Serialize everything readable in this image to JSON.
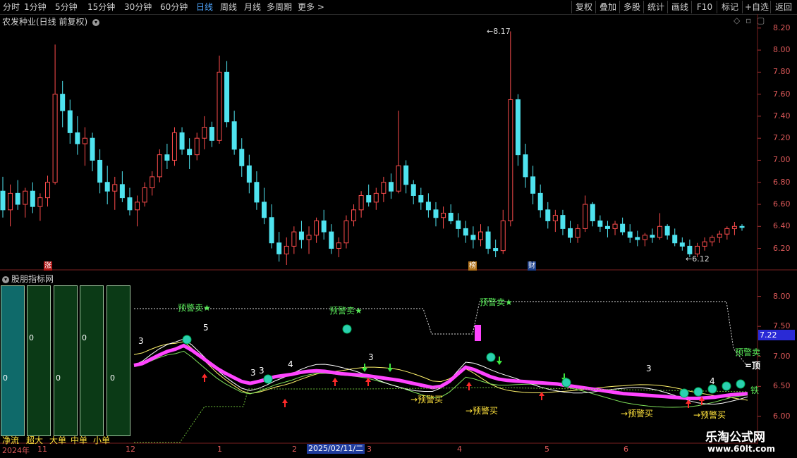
{
  "toolbar": {
    "periods": [
      "分时",
      "1分钟",
      "5分钟",
      "15分钟",
      "30分钟",
      "60分钟",
      "日线",
      "周线",
      "月线",
      "多周期",
      "更多 >"
    ],
    "active_period": "日线",
    "buttons": [
      "复权",
      "叠加",
      "多股",
      "统计",
      "画线",
      "F10",
      "标记",
      "+自选",
      "返回"
    ]
  },
  "main_panel": {
    "title": "农发种业(日线 前复权)",
    "y_ticks": [
      "8.20",
      "8.00",
      "7.80",
      "7.60",
      "7.40",
      "7.20",
      "7.00",
      "6.80",
      "6.60",
      "6.40",
      "6.20"
    ],
    "high_label": "8.17",
    "low_label": "6.12",
    "markers": [
      "涨",
      "榜",
      "财"
    ]
  },
  "indicator_panel": {
    "title": "股朋指标网",
    "y_ticks": [
      "8.00",
      "7.50",
      "7.00",
      "6.50",
      "6.00"
    ],
    "current_value": "7.22",
    "flow_values": [
      "0",
      "0",
      "0",
      "0",
      "0"
    ],
    "flow_labels": [
      "净流",
      "超大",
      "大单",
      "中单",
      "小单"
    ],
    "sell_warn": "预警卖★",
    "buy_warn": "→预警买",
    "side_warn": "预警卖",
    "numbers": [
      "3",
      "5",
      "3",
      "3",
      "4",
      "3",
      "3",
      "4"
    ],
    "right_tag_top": "=顶",
    "right_tag_bottom": "铁"
  },
  "x_axis": {
    "labels": [
      "2024年",
      "11",
      "12",
      "1",
      "2",
      "3",
      "4",
      "5",
      "6"
    ],
    "selected_date": "2025/02/11/二"
  },
  "watermark": {
    "title": "乐淘公式网",
    "url": "www.60lt.com"
  },
  "colors": {
    "up": "#ff4d4d",
    "down": "#4fe3ef",
    "magenta": "#ff44ff",
    "accent": "#4fa6ff"
  },
  "chart_data": {
    "type": "candlestick",
    "series": [
      {
        "name": "",
        "type": "ohlc",
        "values": [
          [
            6.72,
            6.85,
            6.48,
            6.55
          ],
          [
            6.55,
            6.78,
            6.4,
            6.7
          ],
          [
            6.7,
            6.82,
            6.55,
            6.6
          ],
          [
            6.6,
            6.75,
            6.48,
            6.72
          ],
          [
            6.72,
            6.8,
            6.52,
            6.58
          ],
          [
            6.58,
            6.7,
            6.45,
            6.66
          ],
          [
            6.66,
            6.86,
            6.58,
            6.8
          ],
          [
            6.8,
            8.05,
            6.78,
            7.6
          ],
          [
            7.6,
            7.72,
            7.3,
            7.45
          ],
          [
            7.45,
            7.55,
            7.15,
            7.25
          ],
          [
            7.25,
            7.4,
            7.05,
            7.15
          ],
          [
            7.15,
            7.3,
            6.95,
            7.2
          ],
          [
            7.2,
            7.25,
            6.9,
            7.0
          ],
          [
            7.0,
            7.1,
            6.7,
            6.8
          ],
          [
            6.8,
            6.95,
            6.6,
            6.72
          ],
          [
            6.72,
            6.85,
            6.55,
            6.78
          ],
          [
            6.78,
            6.9,
            6.62,
            6.66
          ],
          [
            6.66,
            6.75,
            6.5,
            6.55
          ],
          [
            6.55,
            6.68,
            6.4,
            6.62
          ],
          [
            6.62,
            6.8,
            6.58,
            6.75
          ],
          [
            6.75,
            6.9,
            6.68,
            6.85
          ],
          [
            6.85,
            7.1,
            6.8,
            7.05
          ],
          [
            7.05,
            7.15,
            6.92,
            7.0
          ],
          [
            7.0,
            7.3,
            6.95,
            7.25
          ],
          [
            7.25,
            7.3,
            7.05,
            7.1
          ],
          [
            7.1,
            7.2,
            6.92,
            7.05
          ],
          [
            7.05,
            7.25,
            7.0,
            7.2
          ],
          [
            7.2,
            7.4,
            7.1,
            7.3
          ],
          [
            7.3,
            7.35,
            7.12,
            7.18
          ],
          [
            7.18,
            7.95,
            7.15,
            7.8
          ],
          [
            7.8,
            7.9,
            7.3,
            7.35
          ],
          [
            7.35,
            7.45,
            7.05,
            7.1
          ],
          [
            7.1,
            7.2,
            6.85,
            6.95
          ],
          [
            6.95,
            7.05,
            6.7,
            6.8
          ],
          [
            6.8,
            6.9,
            6.55,
            6.62
          ],
          [
            6.62,
            6.75,
            6.42,
            6.48
          ],
          [
            6.48,
            6.6,
            6.2,
            6.25
          ],
          [
            6.25,
            6.35,
            6.08,
            6.15
          ],
          [
            6.15,
            6.3,
            6.05,
            6.22
          ],
          [
            6.22,
            6.4,
            6.15,
            6.35
          ],
          [
            6.35,
            6.45,
            6.2,
            6.28
          ],
          [
            6.28,
            6.4,
            6.15,
            6.32
          ],
          [
            6.32,
            6.48,
            6.25,
            6.45
          ],
          [
            6.45,
            6.55,
            6.28,
            6.35
          ],
          [
            6.35,
            6.42,
            6.15,
            6.2
          ],
          [
            6.2,
            6.3,
            6.12,
            6.25
          ],
          [
            6.25,
            6.5,
            6.2,
            6.45
          ],
          [
            6.45,
            6.6,
            6.4,
            6.55
          ],
          [
            6.55,
            6.72,
            6.48,
            6.68
          ],
          [
            6.68,
            6.78,
            6.58,
            6.62
          ],
          [
            6.62,
            6.75,
            6.55,
            6.7
          ],
          [
            6.7,
            6.85,
            6.62,
            6.8
          ],
          [
            6.8,
            6.88,
            6.65,
            6.72
          ],
          [
            6.72,
            7.45,
            6.7,
            6.95
          ],
          [
            6.95,
            7.0,
            6.7,
            6.78
          ],
          [
            6.78,
            6.82,
            6.6,
            6.68
          ],
          [
            6.68,
            6.75,
            6.55,
            6.62
          ],
          [
            6.62,
            6.7,
            6.48,
            6.55
          ],
          [
            6.55,
            6.62,
            6.4,
            6.48
          ],
          [
            6.48,
            6.58,
            6.38,
            6.52
          ],
          [
            6.52,
            6.6,
            6.42,
            6.45
          ],
          [
            6.45,
            6.52,
            6.3,
            6.38
          ],
          [
            6.38,
            6.45,
            6.25,
            6.32
          ],
          [
            6.32,
            6.4,
            6.2,
            6.28
          ],
          [
            6.28,
            6.42,
            6.22,
            6.35
          ],
          [
            6.35,
            6.4,
            6.15,
            6.2
          ],
          [
            6.2,
            6.28,
            6.12,
            6.18
          ],
          [
            6.18,
            6.55,
            6.15,
            6.45
          ],
          [
            6.45,
            8.17,
            6.4,
            7.55
          ],
          [
            7.55,
            7.6,
            6.95,
            7.05
          ],
          [
            7.05,
            7.15,
            6.75,
            6.85
          ],
          [
            6.85,
            6.95,
            6.6,
            6.7
          ],
          [
            6.7,
            6.78,
            6.48,
            6.55
          ],
          [
            6.55,
            6.62,
            6.38,
            6.45
          ],
          [
            6.45,
            6.55,
            6.35,
            6.5
          ],
          [
            6.5,
            6.55,
            6.32,
            6.38
          ],
          [
            6.38,
            6.45,
            6.25,
            6.3
          ],
          [
            6.3,
            6.42,
            6.25,
            6.38
          ],
          [
            6.38,
            6.68,
            6.35,
            6.6
          ],
          [
            6.6,
            6.62,
            6.4,
            6.45
          ],
          [
            6.45,
            6.5,
            6.35,
            6.4
          ],
          [
            6.4,
            6.45,
            6.3,
            6.38
          ],
          [
            6.38,
            6.45,
            6.32,
            6.42
          ],
          [
            6.42,
            6.48,
            6.32,
            6.35
          ],
          [
            6.35,
            6.42,
            6.25,
            6.3
          ],
          [
            6.3,
            6.36,
            6.22,
            6.28
          ],
          [
            6.28,
            6.34,
            6.22,
            6.32
          ],
          [
            6.32,
            6.38,
            6.25,
            6.3
          ],
          [
            6.3,
            6.52,
            6.28,
            6.4
          ],
          [
            6.4,
            6.42,
            6.28,
            6.32
          ],
          [
            6.32,
            6.38,
            6.22,
            6.25
          ],
          [
            6.25,
            6.3,
            6.18,
            6.22
          ],
          [
            6.22,
            6.28,
            6.12,
            6.15
          ],
          [
            6.15,
            6.25,
            6.12,
            6.22
          ],
          [
            6.22,
            6.3,
            6.18,
            6.26
          ],
          [
            6.26,
            6.32,
            6.22,
            6.3
          ],
          [
            6.3,
            6.36,
            6.25,
            6.33
          ],
          [
            6.33,
            6.4,
            6.28,
            6.38
          ],
          [
            6.38,
            6.44,
            6.32,
            6.4
          ],
          [
            6.4,
            6.42,
            6.36,
            6.39
          ]
        ]
      }
    ],
    "ylim": [
      6.05,
      8.25
    ],
    "indicator_lines": [
      {
        "name": "",
        "color": "#ff44ff",
        "values": [
          6.85,
          6.88,
          6.95,
          7.02,
          7.08,
          7.12,
          7.18,
          7.1,
          7.0,
          6.9,
          6.8,
          6.72,
          6.65,
          6.58,
          6.55,
          6.58,
          6.62,
          6.66,
          6.68,
          6.7,
          6.73,
          6.75,
          6.76,
          6.75,
          6.73,
          6.71,
          6.7,
          6.69,
          6.68,
          6.66,
          6.64,
          6.62,
          6.6,
          6.57,
          6.54,
          6.51,
          6.48,
          6.5,
          6.58,
          6.7,
          6.82,
          6.78,
          6.72,
          6.66,
          6.62,
          6.6,
          6.59,
          6.58,
          6.57,
          6.56,
          6.55,
          6.54,
          6.52,
          6.5,
          6.48,
          6.46,
          6.44,
          6.42,
          6.4,
          6.38,
          6.37,
          6.36,
          6.35,
          6.34,
          6.33,
          6.32,
          6.31,
          6.3,
          6.3,
          6.31,
          6.32,
          6.34,
          6.36,
          6.37,
          6.38
        ]
      }
    ]
  }
}
